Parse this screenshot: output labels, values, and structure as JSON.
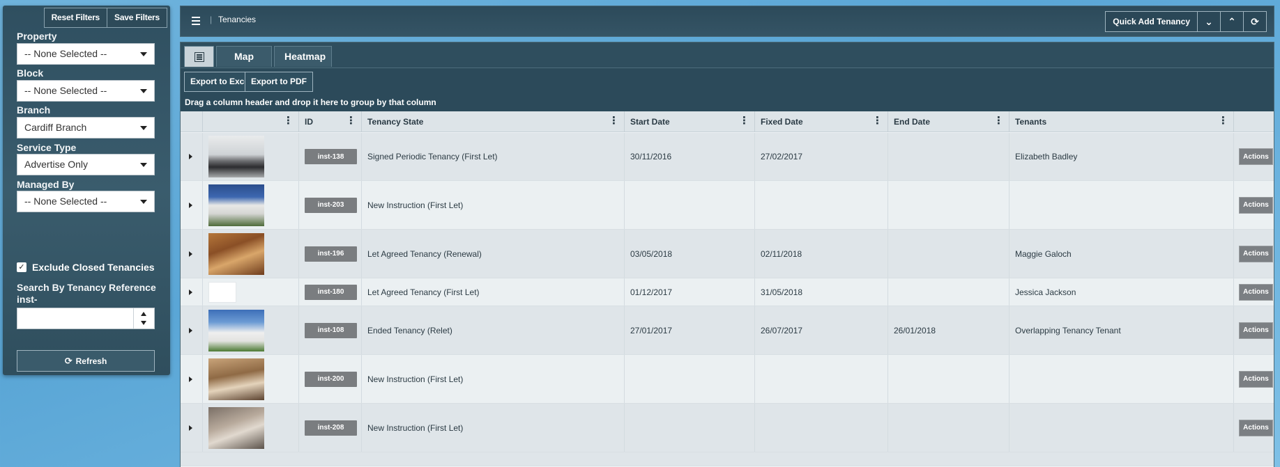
{
  "filters": {
    "reset_label": "Reset Filters",
    "save_label": "Save Filters",
    "property_label": "Property",
    "property_value": "-- None Selected --",
    "block_label": "Block",
    "block_value": "-- None Selected --",
    "branch_label": "Branch",
    "branch_value": "Cardiff Branch",
    "service_type_label": "Service Type",
    "service_type_value": "Advertise Only",
    "managed_by_label": "Managed By",
    "managed_by_value": "-- None Selected --",
    "exclude_closed_label": "Exclude Closed Tenancies",
    "exclude_closed_checked": true,
    "search_label": "Search By Tenancy Reference",
    "search_prefix": "inst-",
    "search_value": "",
    "refresh_label": "Refresh"
  },
  "topbar": {
    "breadcrumb_sep": "|",
    "title": "Tenancies",
    "quick_add_label": "Quick Add Tenancy"
  },
  "tabs": {
    "map_label": "Map",
    "heatmap_label": "Heatmap"
  },
  "toolbar": {
    "export_excel_label": "Export to Excel",
    "export_pdf_label": "Export to PDF",
    "group_hint": "Drag a column header and drop it here to group by that column"
  },
  "grid": {
    "columns": {
      "id": "ID",
      "state": "Tenancy State",
      "start": "Start Date",
      "fixed": "Fixed Date",
      "end": "End Date",
      "tenants": "Tenants"
    },
    "action_label": "Actions",
    "rows": [
      {
        "id": "inst-138",
        "state": "Signed Periodic Tenancy (First Let)",
        "start": "30/11/2016",
        "fixed": "27/02/2017",
        "end": "",
        "tenants": "Elizabeth Badley",
        "thumb": "living-room"
      },
      {
        "id": "inst-203",
        "state": "New Instruction (First Let)",
        "start": "",
        "fixed": "",
        "end": "",
        "tenants": "",
        "thumb": "apartment-block"
      },
      {
        "id": "inst-196",
        "state": "Let Agreed Tenancy (Renewal)",
        "start": "03/05/2018",
        "fixed": "02/11/2018",
        "end": "",
        "tenants": "Maggie Galoch",
        "thumb": "lounge-wood"
      },
      {
        "id": "inst-180",
        "state": "Let Agreed Tenancy (First Let)",
        "start": "01/12/2017",
        "fixed": "31/05/2018",
        "end": "",
        "tenants": "Jessica Jackson",
        "thumb": "placeholder"
      },
      {
        "id": "inst-108",
        "state": "Ended Tenancy (Relet)",
        "start": "27/01/2017",
        "fixed": "26/07/2017",
        "end": "26/01/2018",
        "tenants": "Overlapping Tenancy Tenant",
        "thumb": "house"
      },
      {
        "id": "inst-200",
        "state": "New Instruction (First Let)",
        "start": "",
        "fixed": "",
        "end": "",
        "tenants": "",
        "thumb": "sitting-room"
      },
      {
        "id": "inst-208",
        "state": "New Instruction (First Let)",
        "start": "",
        "fixed": "",
        "end": "",
        "tenants": "",
        "thumb": "bedroom"
      }
    ]
  },
  "colors": {
    "panel": "#2f4f60",
    "badge": "#7a7d80",
    "row_odd": "#dfe5e9",
    "row_even": "#ebf0f2"
  }
}
